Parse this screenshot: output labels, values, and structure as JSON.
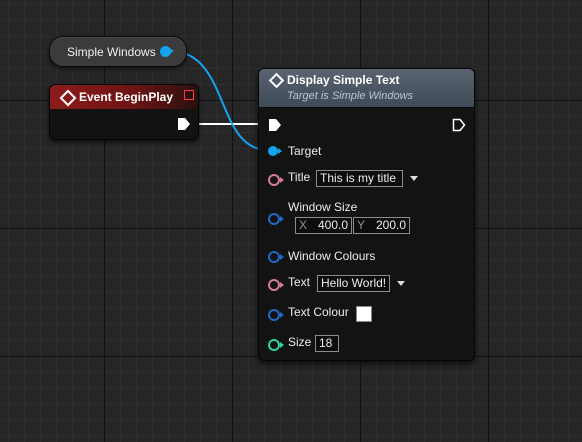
{
  "variable_node": {
    "label": "Simple Windows",
    "pin_color": "#15a3f0"
  },
  "event_node": {
    "title": "Event BeginPlay",
    "header_color": "#8c1c1c"
  },
  "function_node": {
    "title": "Display Simple Text",
    "subtitle": "Target is Simple Windows",
    "pins": {
      "target": {
        "label": "Target",
        "color": "#15a3f0"
      },
      "title": {
        "label": "Title",
        "value": "This is my title",
        "color": "#d47c9d"
      },
      "window_size": {
        "label": "Window Size",
        "x_axis": "X",
        "x_value": "400.0",
        "y_axis": "Y",
        "y_value": "200.0",
        "color": "#1f68c8"
      },
      "window_colours": {
        "label": "Window Colours",
        "color": "#1f68c8"
      },
      "text": {
        "label": "Text",
        "value": "Hello World!",
        "color": "#d47c9d"
      },
      "text_colour": {
        "label": "Text Colour",
        "value_color": "#ffffff",
        "color": "#1f68c8"
      },
      "size": {
        "label": "Size",
        "value": "18",
        "color": "#2fd4a3"
      }
    }
  }
}
